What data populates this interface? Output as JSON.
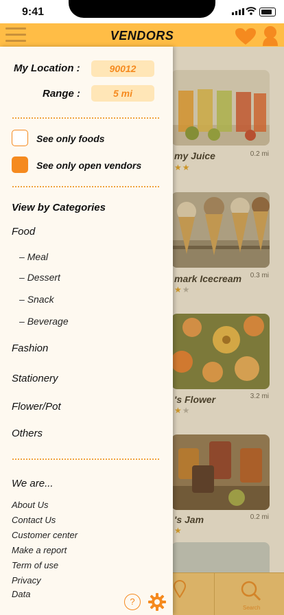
{
  "status_bar": {
    "time": "9:41"
  },
  "header": {
    "title": "VENDORS"
  },
  "drawer": {
    "location_label": "My Location :",
    "location_value": "90012",
    "range_label": "Range :",
    "range_value": "5 mi",
    "filters": [
      {
        "label": "See only foods",
        "checked": false
      },
      {
        "label": "See only open vendors",
        "checked": true
      }
    ],
    "categories_heading": "View by Categories",
    "categories": {
      "food": "Food",
      "food_subs": [
        "Meal",
        "Dessert",
        "Snack",
        "Beverage"
      ],
      "others": [
        "Fashion",
        "Stationery",
        "Flower/Pot",
        "Others"
      ]
    },
    "about_heading": "We are...",
    "links": [
      "About Us",
      "Contact Us",
      "Customer center",
      "Make a report",
      "Term of use",
      "Privacy",
      "Data"
    ],
    "help_icon_glyph": "?"
  },
  "vendors": [
    {
      "name": "my Juice",
      "distance": "0.2 mi"
    },
    {
      "name": "mark Icecream",
      "distance": "0.3 mi"
    },
    {
      "name": "'s Flower",
      "distance": "3.2 mi"
    },
    {
      "name": "'s Jam",
      "distance": "0.2 mi"
    }
  ],
  "tabbar": {
    "search_label": "Search"
  },
  "colors": {
    "accent": "#ffbd46",
    "orange": "#f58a1f",
    "drawer_bg": "#fef9f0"
  }
}
